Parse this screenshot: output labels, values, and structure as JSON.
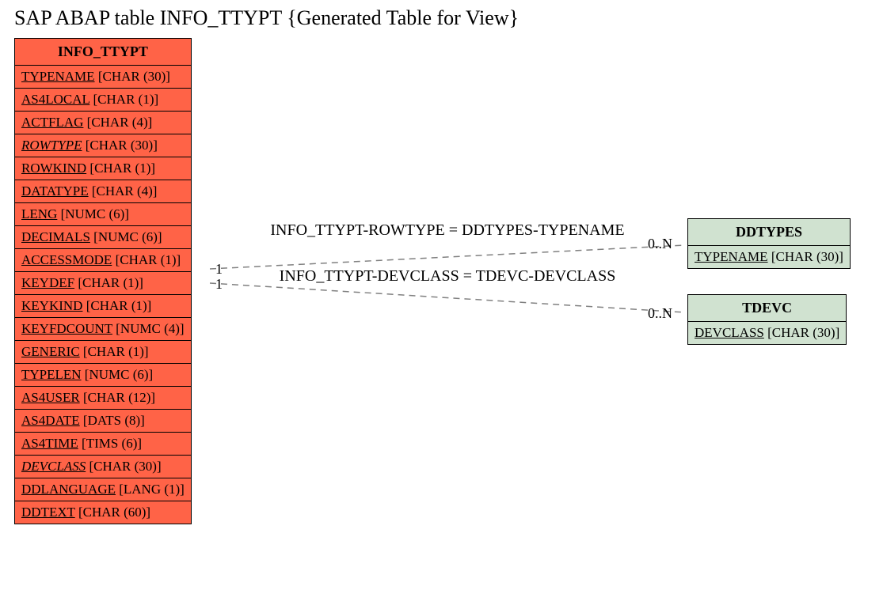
{
  "title": "SAP ABAP table INFO_TTYPT {Generated Table for View}",
  "entities": {
    "info_ttypt": {
      "name": "INFO_TTYPT",
      "fields": [
        {
          "n": "TYPENAME",
          "t": "[CHAR (30)]",
          "i": false
        },
        {
          "n": "AS4LOCAL",
          "t": "[CHAR (1)]",
          "i": false
        },
        {
          "n": "ACTFLAG",
          "t": "[CHAR (4)]",
          "i": false
        },
        {
          "n": "ROWTYPE",
          "t": "[CHAR (30)]",
          "i": true
        },
        {
          "n": "ROWKIND",
          "t": "[CHAR (1)]",
          "i": false
        },
        {
          "n": "DATATYPE",
          "t": "[CHAR (4)]",
          "i": false
        },
        {
          "n": "LENG",
          "t": "[NUMC (6)]",
          "i": false
        },
        {
          "n": "DECIMALS",
          "t": "[NUMC (6)]",
          "i": false
        },
        {
          "n": "ACCESSMODE",
          "t": "[CHAR (1)]",
          "i": false
        },
        {
          "n": "KEYDEF",
          "t": "[CHAR (1)]",
          "i": false
        },
        {
          "n": "KEYKIND",
          "t": "[CHAR (1)]",
          "i": false
        },
        {
          "n": "KEYFDCOUNT",
          "t": "[NUMC (4)]",
          "i": false
        },
        {
          "n": "GENERIC",
          "t": "[CHAR (1)]",
          "i": false
        },
        {
          "n": "TYPELEN",
          "t": "[NUMC (6)]",
          "i": false
        },
        {
          "n": "AS4USER",
          "t": "[CHAR (12)]",
          "i": false
        },
        {
          "n": "AS4DATE",
          "t": "[DATS (8)]",
          "i": false
        },
        {
          "n": "AS4TIME",
          "t": "[TIMS (6)]",
          "i": false
        },
        {
          "n": "DEVCLASS",
          "t": "[CHAR (30)]",
          "i": true
        },
        {
          "n": "DDLANGUAGE",
          "t": "[LANG (1)]",
          "i": false
        },
        {
          "n": "DDTEXT",
          "t": "[CHAR (60)]",
          "i": false
        }
      ]
    },
    "ddtypes": {
      "name": "DDTYPES",
      "fields": [
        {
          "n": "TYPENAME",
          "t": "[CHAR (30)]",
          "i": false
        }
      ]
    },
    "tdevc": {
      "name": "TDEVC",
      "fields": [
        {
          "n": "DEVCLASS",
          "t": "[CHAR (30)]",
          "i": false
        }
      ]
    }
  },
  "relations": [
    {
      "label": "INFO_TTYPT-ROWTYPE = DDTYPES-TYPENAME",
      "left_card": "1",
      "right_card": "0..N"
    },
    {
      "label": "INFO_TTYPT-DEVCLASS = TDEVC-DEVCLASS",
      "left_card": "1",
      "right_card": "0..N"
    }
  ]
}
